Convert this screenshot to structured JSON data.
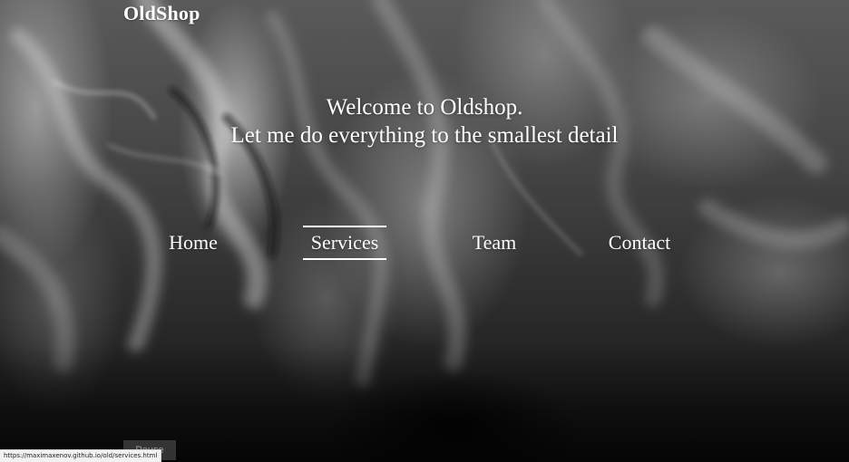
{
  "brand": {
    "logo_text": "OldShop"
  },
  "hero": {
    "line1": "Welcome to Oldshop.",
    "line2": "Let me do everything to the smallest detail"
  },
  "nav": {
    "items": [
      {
        "label": "Home",
        "active": false
      },
      {
        "label": "Services",
        "active": true
      },
      {
        "label": "Team",
        "active": false
      },
      {
        "label": "Contact",
        "active": false
      }
    ]
  },
  "controls": {
    "pause_label": "Pause"
  },
  "status_bar": {
    "url": "https://maximaxenov.github.io/old/services.html"
  },
  "colors": {
    "text": "#ffffff",
    "background_dark": "#111111",
    "status_bg": "#f2f2f2"
  }
}
